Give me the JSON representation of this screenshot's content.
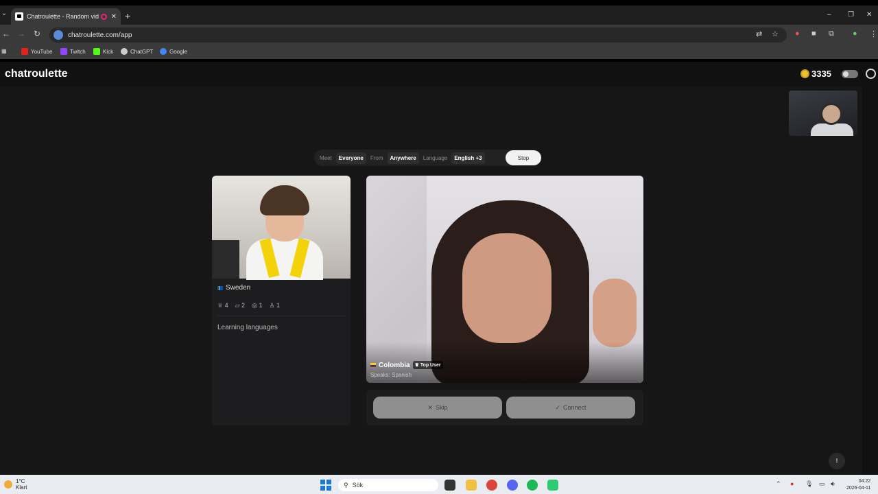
{
  "browser": {
    "tab_title": "Chatroulette - Random vid",
    "tab_close": "✕",
    "new_tab": "+",
    "url": "chatroulette.com/app",
    "window_controls": [
      "–",
      "❐",
      "✕"
    ]
  },
  "bookmarks": [
    {
      "label": "YouTube",
      "color": "#e62117"
    },
    {
      "label": "Twitch",
      "color": "#9146ff"
    },
    {
      "label": "Kick",
      "color": "#53fc18"
    },
    {
      "label": "ChatGPT",
      "color": "#cccccc"
    },
    {
      "label": "Google",
      "color": "#4285f4"
    }
  ],
  "app": {
    "logo": "chatroulette",
    "coins": "3335",
    "filters": {
      "meet_label": "Meet",
      "meet_value": "Everyone",
      "from_label": "From",
      "from_value": "Anywhere",
      "language_label": "Language",
      "language_value": "English +3",
      "stop": "Stop"
    },
    "partner": {
      "country": "Sweden",
      "stats": [
        "4",
        "2",
        "1",
        "1"
      ],
      "bio": "Learning languages"
    },
    "stranger": {
      "country": "Colombia",
      "badge": "Top User",
      "speaks": "Speaks: Spanish"
    },
    "actions": {
      "skip": "Skip",
      "connect": "Connect"
    }
  },
  "taskbar": {
    "temperature": "1°C",
    "weather": "Klart",
    "search_placeholder": "Sök",
    "time": "04:22",
    "date": "2026-04-11"
  }
}
